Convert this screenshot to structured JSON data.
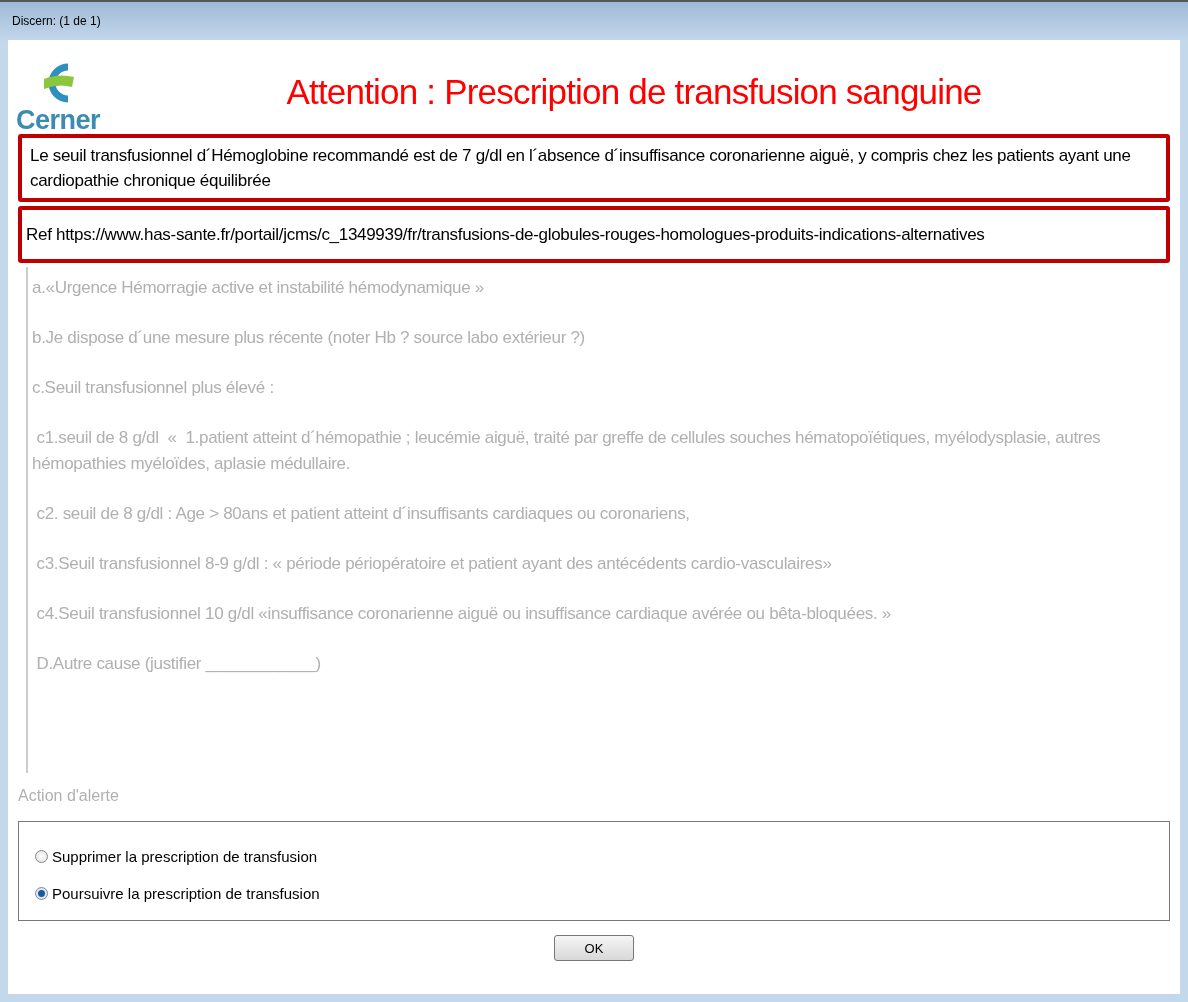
{
  "window": {
    "title": "Discern:  (1 de 1)"
  },
  "logo": {
    "text": "Cerner"
  },
  "heading": "Attention : Prescription de transfusion sanguine",
  "notice": "Le seuil transfusionnel d´Hémoglobine recommandé est de 7 g/dl en l´absence d´insuffisance coronarienne aiguë, y compris chez les patients ayant une cardiopathie chronique équilibrée",
  "reference": "Ref  https://www.has-sante.fr/portail/jcms/c_1349939/fr/transfusions-de-globules-rouges-homologues-produits-indications-alternatives",
  "criteria": [
    "a.«Urgence Hémorragie active et instabilité hémodynamique »",
    "b.Je dispose d´une mesure plus récente (noter Hb ? source labo extérieur ?)",
    "c.Seuil transfusionnel plus élevé :",
    " c1.seuil de 8 g/dl  «  1.patient atteint d´hémopathie ; leucémie aiguë, traité par greffe de cellules souches hématopoïétiques, myélodysplasie, autres hémopathies myéloïdes, aplasie médullaire.",
    " c2. seuil de 8 g/dl : Age > 80ans et patient atteint d´insuffisants cardiaques ou coronariens,",
    " c3.Seuil transfusionnel 8-9 g/dl : « période périopératoire et patient ayant des antécédents cardio-vasculaires»",
    " c4.Seuil transfusionnel 10 g/dl «insuffisance coronarienne aiguë ou insuffisance cardiaque avérée ou bêta-bloquées. »",
    " D.Autre cause (justifier ____________)"
  ],
  "action": {
    "label": "Action d'alerte",
    "options": [
      {
        "label": "Supprimer la prescription de transfusion",
        "selected": false
      },
      {
        "label": "Poursuivre la prescription de transfusion",
        "selected": true
      }
    ]
  },
  "buttons": [
    "OK"
  ]
}
